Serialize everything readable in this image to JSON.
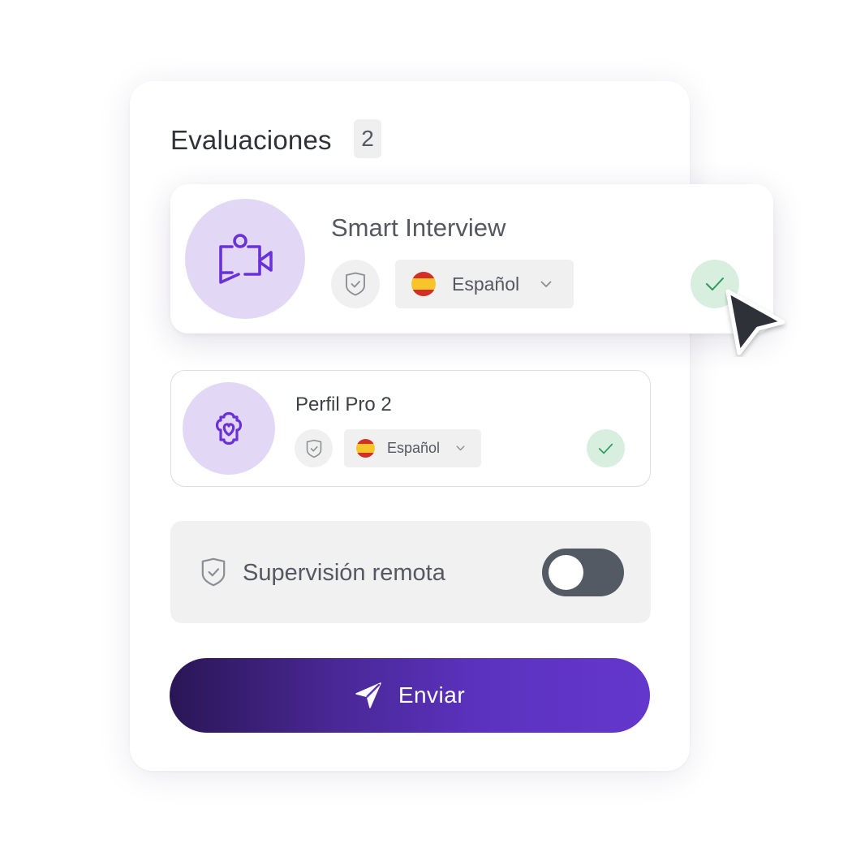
{
  "evaluations": {
    "title": "Evaluaciones",
    "count": "2"
  },
  "cards": [
    {
      "title": "Smart Interview",
      "icon": "video-interview-icon",
      "language": "Español",
      "flag": "spain-flag-icon",
      "checked": true
    },
    {
      "title": "Perfil Pro 2",
      "icon": "puzzle-heart-icon",
      "language": "Español",
      "flag": "spain-flag-icon",
      "checked": true
    }
  ],
  "supervision": {
    "label": "Supervisión remota",
    "enabled": false
  },
  "send_button": {
    "label": "Enviar",
    "icon": "send-icon"
  },
  "colors": {
    "accent_purple": "#6a32d6",
    "icon_circle_bg": "#e2d8f6",
    "check_green": "#2e9a5a",
    "check_bg": "#d8efe0",
    "toggle_track": "#545a63",
    "button_gradient_start": "#2a1655",
    "button_gradient_end": "#6437cc"
  }
}
